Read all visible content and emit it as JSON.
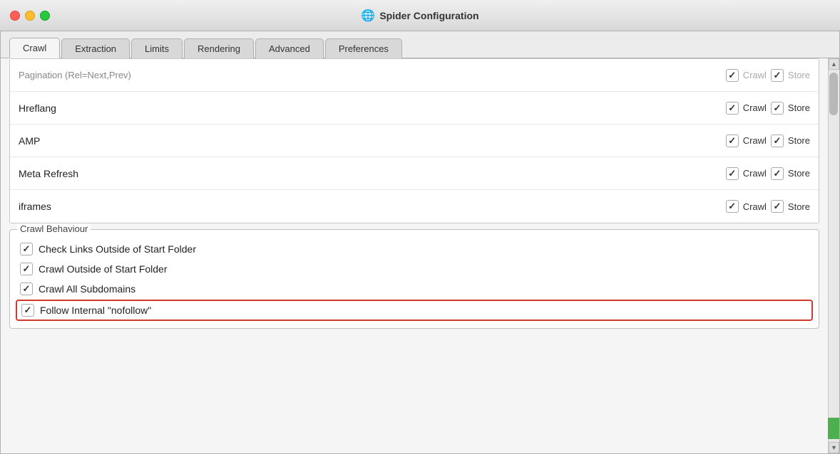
{
  "titleBar": {
    "title": "Spider Configuration",
    "globeIcon": "🌐"
  },
  "tabs": [
    {
      "id": "crawl",
      "label": "Crawl",
      "active": true
    },
    {
      "id": "extraction",
      "label": "Extraction",
      "active": false
    },
    {
      "id": "limits",
      "label": "Limits",
      "active": false
    },
    {
      "id": "rendering",
      "label": "Rendering",
      "active": false
    },
    {
      "id": "advanced",
      "label": "Advanced",
      "active": false
    },
    {
      "id": "preferences",
      "label": "Preferences",
      "active": false
    }
  ],
  "tableRows": [
    {
      "id": "pagination",
      "label": "Pagination (Rel=Next,Prev)",
      "crawlChecked": true,
      "storeChecked": true,
      "faded": true
    },
    {
      "id": "hreflang",
      "label": "Hreflang",
      "crawlChecked": true,
      "storeChecked": true,
      "faded": false
    },
    {
      "id": "amp",
      "label": "AMP",
      "crawlChecked": true,
      "storeChecked": true,
      "faded": false
    },
    {
      "id": "meta-refresh",
      "label": "Meta Refresh",
      "crawlChecked": true,
      "storeChecked": true,
      "faded": false
    },
    {
      "id": "iframes",
      "label": "iframes",
      "crawlChecked": true,
      "storeChecked": true,
      "faded": false
    }
  ],
  "crawlBehaviour": {
    "sectionLabel": "Crawl Behaviour",
    "items": [
      {
        "id": "check-links-outside",
        "label": "Check Links Outside of Start Folder",
        "checked": true,
        "highlighted": false
      },
      {
        "id": "crawl-outside",
        "label": "Crawl Outside of Start Folder",
        "checked": true,
        "highlighted": false
      },
      {
        "id": "crawl-all-subdomains",
        "label": "Crawl All Subdomains",
        "checked": true,
        "highlighted": false
      },
      {
        "id": "follow-nofollow",
        "label": "Follow Internal \"nofollow\"",
        "checked": true,
        "highlighted": true
      }
    ]
  },
  "labels": {
    "crawl": "Crawl",
    "store": "Store"
  }
}
